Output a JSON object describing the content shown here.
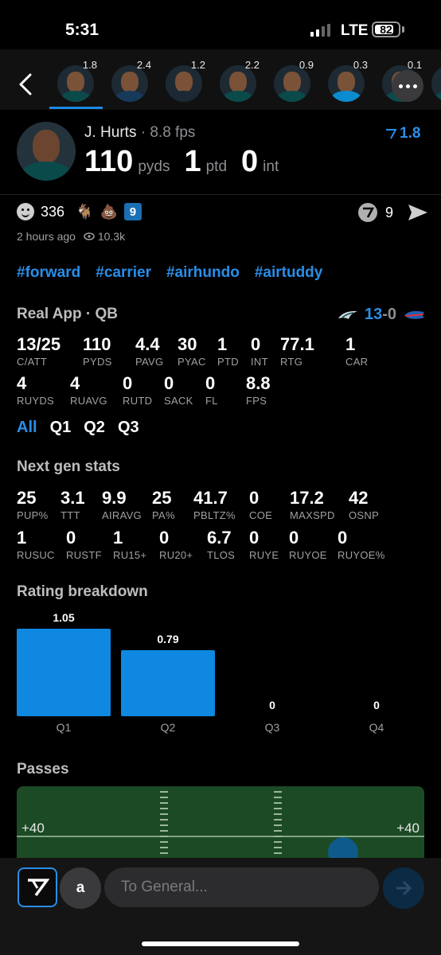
{
  "status_bar": {
    "time": "5:31",
    "network": "LTE",
    "battery": "82"
  },
  "player_strip": {
    "items": [
      {
        "score": "1.8",
        "jersey": "#0b4a4a"
      },
      {
        "score": "2.4",
        "jersey": "#173a5a"
      },
      {
        "score": "1.2",
        "jersey": "#1c2833"
      },
      {
        "score": "2.2",
        "jersey": "#0b4a4a"
      },
      {
        "score": "0.9",
        "jersey": "#0b4a4a"
      },
      {
        "score": "0.3",
        "jersey": "#0a8ccf"
      },
      {
        "score": "0.1",
        "jersey": "#0b4a4a"
      },
      {
        "score": "",
        "jersey": "#0b4a4a"
      }
    ]
  },
  "player": {
    "name": "J. Hurts",
    "fps": "8.8 fps",
    "rating": "1.8",
    "stats": [
      {
        "value": "110",
        "unit": "pyds"
      },
      {
        "value": "1",
        "unit": "ptd"
      },
      {
        "value": "0",
        "unit": "int"
      }
    ]
  },
  "reactions": {
    "smile_count": "336",
    "goat": "🐐",
    "poop": "💩",
    "badge": "9",
    "v_count": "9",
    "posted": "2 hours ago",
    "views": "10.3k"
  },
  "hashtags": [
    "#forward",
    "#carrier",
    "#airhundo",
    "#airtuddy"
  ],
  "real_app": {
    "title": "Real App · QB",
    "score_home": "13",
    "score_sep": "-",
    "score_away": "0",
    "row1": [
      {
        "v": "13/25",
        "l": "C/ATT"
      },
      {
        "v": "110",
        "l": "PYDS"
      },
      {
        "v": "4.4",
        "l": "PAVG"
      },
      {
        "v": "30",
        "l": "PYAC"
      },
      {
        "v": "1",
        "l": "PTD"
      },
      {
        "v": "0",
        "l": "INT"
      },
      {
        "v": "77.1",
        "l": "RTG"
      },
      {
        "v": "1",
        "l": "CAR"
      }
    ],
    "row2": [
      {
        "v": "4",
        "l": "RUYDS"
      },
      {
        "v": "4",
        "l": "RUAVG"
      },
      {
        "v": "0",
        "l": "RUTD"
      },
      {
        "v": "0",
        "l": "SACK"
      },
      {
        "v": "0",
        "l": "FL"
      },
      {
        "v": "8.8",
        "l": "FPS"
      }
    ],
    "tabs": [
      "All",
      "Q1",
      "Q2",
      "Q3"
    ]
  },
  "next_gen": {
    "title": "Next gen stats",
    "row1": [
      {
        "v": "25",
        "l": "PUP%"
      },
      {
        "v": "3.1",
        "l": "TTT"
      },
      {
        "v": "9.9",
        "l": "AIRAVG"
      },
      {
        "v": "25",
        "l": "PA%"
      },
      {
        "v": "41.7",
        "l": "PBLTZ%"
      },
      {
        "v": "0",
        "l": "COE"
      },
      {
        "v": "17.2",
        "l": "MAXSPD"
      },
      {
        "v": "42",
        "l": "OSNP"
      }
    ],
    "row2": [
      {
        "v": "1",
        "l": "RUSUC"
      },
      {
        "v": "0",
        "l": "RUSTF"
      },
      {
        "v": "1",
        "l": "RU15+"
      },
      {
        "v": "0",
        "l": "RU20+"
      },
      {
        "v": "6.7",
        "l": "TLOS"
      },
      {
        "v": "0",
        "l": "RUYE"
      },
      {
        "v": "0",
        "l": "RUYOE"
      },
      {
        "v": "0",
        "l": "RUYOE%"
      }
    ]
  },
  "rating_breakdown": {
    "title": "Rating breakdown"
  },
  "chart_data": {
    "type": "bar",
    "categories": [
      "Q1",
      "Q2",
      "Q3",
      "Q4"
    ],
    "values": [
      1.05,
      0.79,
      0,
      0
    ],
    "value_labels": [
      "1.05",
      "0.79",
      "0",
      "0"
    ],
    "color": "#0e88e0"
  },
  "passes": {
    "title": "Passes",
    "yard_left": "+40",
    "yard_right": "+40"
  },
  "composer": {
    "avatar_letter": "a",
    "placeholder": "To General..."
  },
  "colors": {
    "accent": "#2a8ee8",
    "bar": "#0e88e0",
    "field": "#1c4a24"
  }
}
